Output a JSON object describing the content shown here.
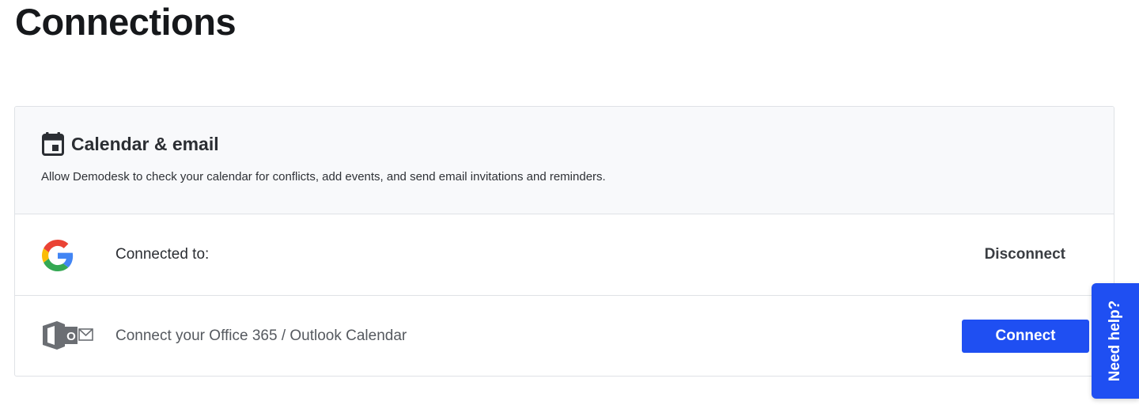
{
  "page": {
    "title": "Connections"
  },
  "calendar_section": {
    "icon": "calendar-icon",
    "title": "Calendar & email",
    "description": "Allow Demodesk to check your calendar for conflicts, add events, and send email invitations and reminders."
  },
  "google_row": {
    "icon": "google-icon",
    "label": "Connected to:",
    "action_label": "Disconnect"
  },
  "office_row": {
    "icon": "office-365-icon",
    "label": "Connect your Office 365 / Outlook Calendar",
    "action_label": "Connect"
  },
  "help": {
    "label": "Need help?"
  },
  "colors": {
    "accent": "#1f4ff2",
    "header_bg": "#f8f9fb",
    "border": "#dfe2e6"
  }
}
